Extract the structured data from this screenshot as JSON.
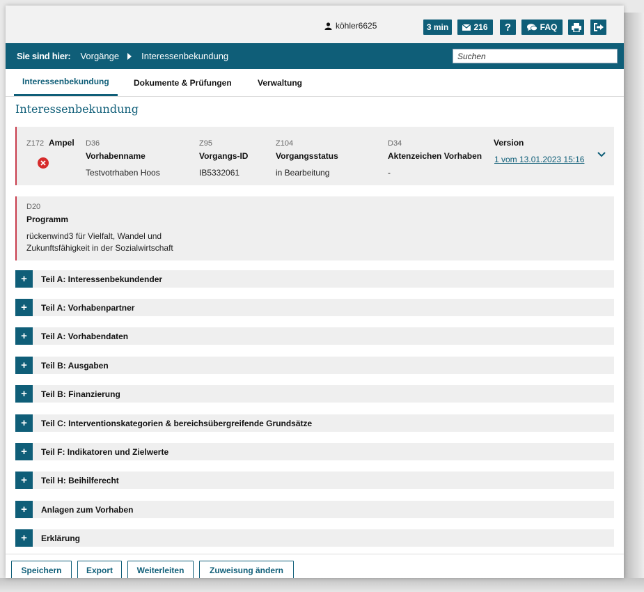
{
  "header": {
    "username": "köhler6625",
    "session_timer": "3 min",
    "messages_count": "216",
    "help_label": "?",
    "faq_label": "FAQ"
  },
  "breadcrumb": {
    "label": "Sie sind hier:",
    "items": [
      "Vorgänge",
      "Interessenbekundung"
    ]
  },
  "search": {
    "placeholder": "Suchen"
  },
  "tabs": [
    {
      "label": "Interessenbekundung",
      "active": true
    },
    {
      "label": "Dokumente & Prüfungen",
      "active": false
    },
    {
      "label": "Verwaltung",
      "active": false
    }
  ],
  "page_title": "Interessenbekundung",
  "info": {
    "ampel": {
      "code": "Z172",
      "label": "Ampel",
      "status": "error"
    },
    "vorhabenname": {
      "code": "D36",
      "label": "Vorhabenname",
      "value": "Testvotrhaben Hoos"
    },
    "vorgangs_id": {
      "code": "Z95",
      "label": "Vorgangs-ID",
      "value": "IB5332061"
    },
    "vorgangsstatus": {
      "code": "Z104",
      "label": "Vorgangsstatus",
      "value": "in Bearbeitung"
    },
    "aktenzeichen": {
      "code": "D34",
      "label": "Aktenzeichen Vorhaben",
      "value": "-"
    },
    "version": {
      "label": "Version",
      "value": "1 vom 13.01.2023 15:16"
    },
    "programm": {
      "code": "D20",
      "label": "Programm",
      "value_line1": "rückenwind3 für Vielfalt, Wandel und",
      "value_line2": "Zukunftsfähigkeit in der Sozialwirtschaft"
    }
  },
  "sections": [
    "Teil A: Interessenbekundender",
    "Teil A: Vorhabenpartner",
    "Teil A: Vorhabendaten",
    "Teil B: Ausgaben",
    "Teil B: Finanzierung",
    "Teil C: Interventionskategorien & bereichsübergreifende Grundsätze",
    "Teil F: Indikatoren und Zielwerte",
    "Teil H: Beihilferecht",
    "Anlagen zum Vorhaben",
    "Erklärung"
  ],
  "footer": {
    "buttons": [
      "Speichern",
      "Export",
      "Weiterleiten",
      "Zuweisung ändern"
    ]
  },
  "colors": {
    "primary": "#0f5e78",
    "error": "#d62b2b",
    "accent_border": "#c83c4c"
  }
}
